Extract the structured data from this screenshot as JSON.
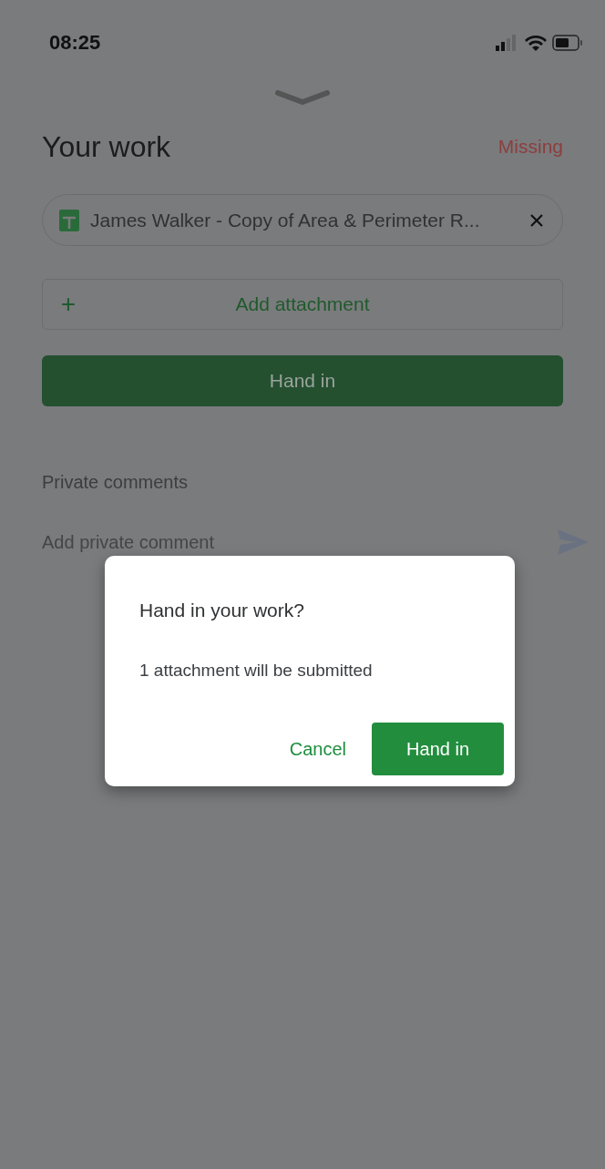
{
  "status_bar": {
    "time": "08:25"
  },
  "header": {
    "title": "Your work",
    "status": "Missing"
  },
  "attachments": [
    {
      "name": "James Walker - Copy of Area & Perimeter R..."
    }
  ],
  "add_attachment": {
    "icon": "+",
    "label": "Add attachment"
  },
  "hand_in_button": {
    "label": "Hand in",
    "disabled": true
  },
  "private_comments": {
    "title": "Private comments",
    "placeholder": "Add private comment"
  },
  "dialog": {
    "title": "Hand in your work?",
    "message": "1 attachment will be submitted",
    "buttons": [
      {
        "label": "Cancel",
        "kind": "text"
      },
      {
        "label": "Hand in",
        "kind": "filled"
      }
    ]
  }
}
